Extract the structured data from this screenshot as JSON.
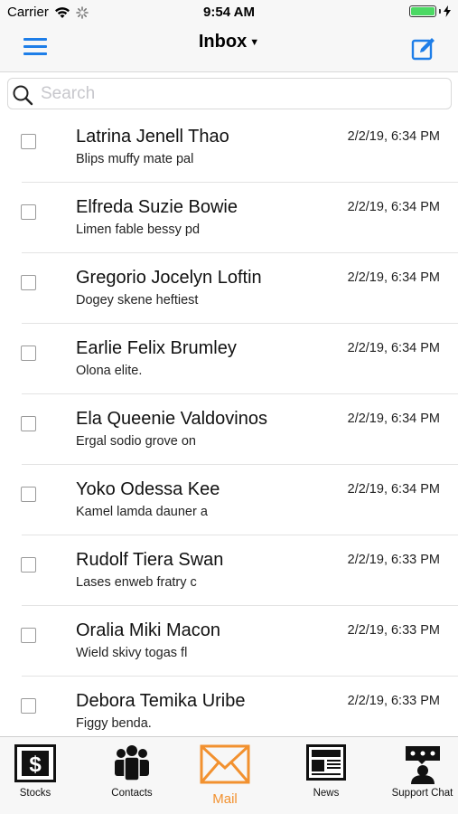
{
  "status_bar": {
    "carrier": "Carrier",
    "time": "9:54 AM"
  },
  "nav": {
    "title": "Inbox",
    "caret": "▼"
  },
  "search": {
    "placeholder": "Search"
  },
  "colors": {
    "accent_blue": "#1e7ee8",
    "active_tab_orange": "#f2912f"
  },
  "messages": [
    {
      "sender": "Latrina Jenell Thao",
      "preview": "Blips muffy mate pal",
      "date": "2/2/19, 6:34 PM"
    },
    {
      "sender": "Elfreda Suzie Bowie",
      "preview": "Limen fable bessy pd",
      "date": "2/2/19, 6:34 PM"
    },
    {
      "sender": "Gregorio Jocelyn Loftin",
      "preview": "Dogey skene heftiest",
      "date": "2/2/19, 6:34 PM"
    },
    {
      "sender": "Earlie Felix Brumley",
      "preview": "Olona elite.",
      "date": "2/2/19, 6:34 PM"
    },
    {
      "sender": "Ela Queenie Valdovinos",
      "preview": "Ergal sodio grove on",
      "date": "2/2/19, 6:34 PM"
    },
    {
      "sender": "Yoko Odessa Kee",
      "preview": "Kamel lamda dauner a",
      "date": "2/2/19, 6:34 PM"
    },
    {
      "sender": "Rudolf Tiera Swan",
      "preview": "Lases enweb fratry c",
      "date": "2/2/19, 6:33 PM"
    },
    {
      "sender": "Oralia Miki Macon",
      "preview": "Wield skivy togas fl",
      "date": "2/2/19, 6:33 PM"
    },
    {
      "sender": "Debora Temika Uribe",
      "preview": "Figgy benda.",
      "date": "2/2/19, 6:33 PM"
    }
  ],
  "tabs": [
    {
      "label": "Stocks",
      "icon": "stocks-icon",
      "active": false
    },
    {
      "label": "Contacts",
      "icon": "contacts-icon",
      "active": false
    },
    {
      "label": "Mail",
      "icon": "mail-icon",
      "active": true
    },
    {
      "label": "News",
      "icon": "news-icon",
      "active": false
    },
    {
      "label": "Support Chat",
      "icon": "support-chat-icon",
      "active": false
    }
  ]
}
